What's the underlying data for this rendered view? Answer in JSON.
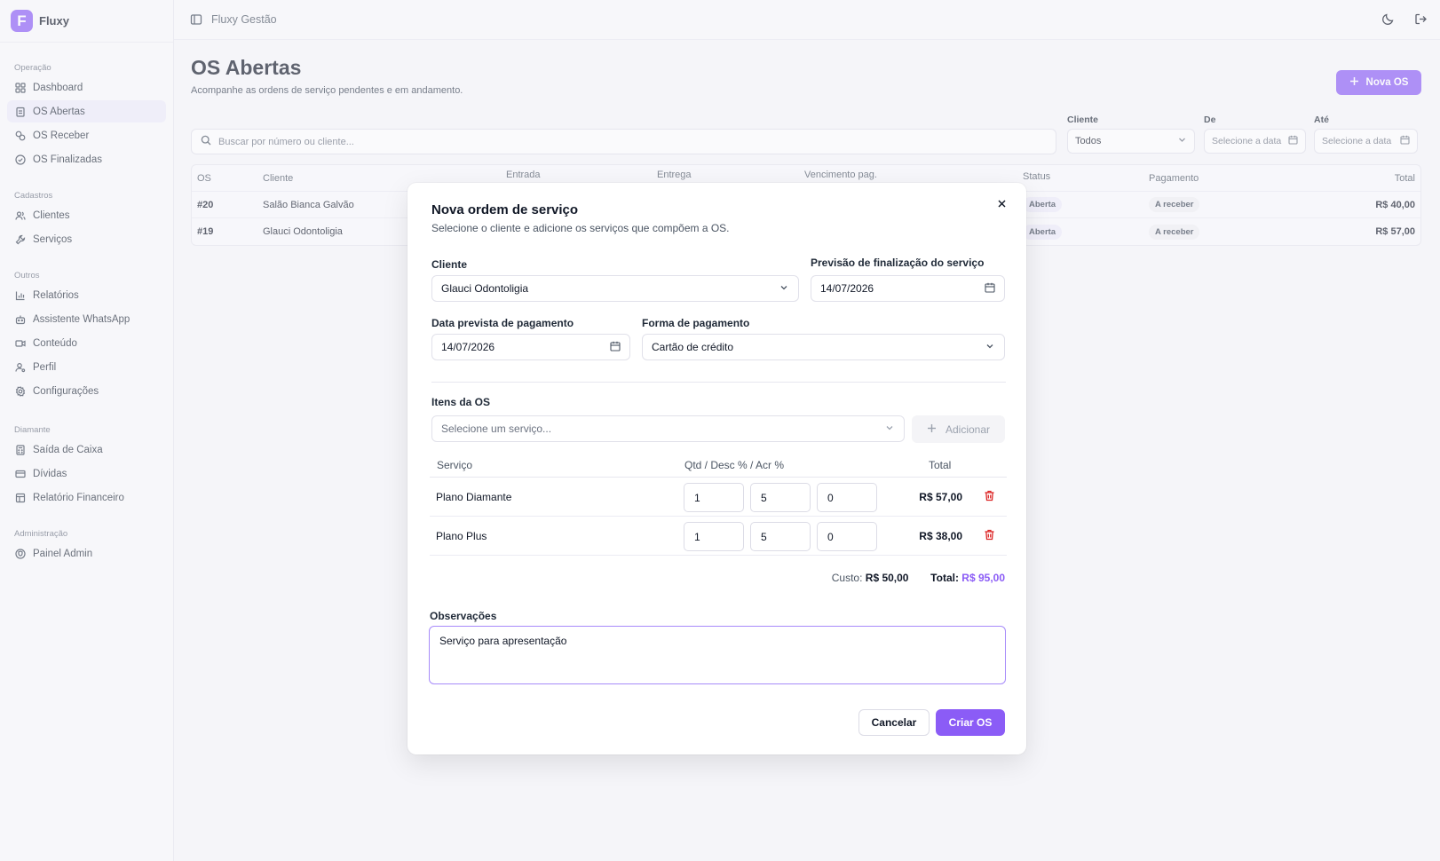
{
  "brand": {
    "logo_letter": "F",
    "name": "Fluxy",
    "color": "#8b5cf6"
  },
  "topbar": {
    "title": "Fluxy Gestão"
  },
  "sidebar": {
    "sections": [
      {
        "heading": "Operação",
        "items": [
          {
            "label": "Dashboard",
            "icon": "grid-icon"
          },
          {
            "label": "OS Abertas",
            "icon": "clipboard-icon",
            "active": true
          },
          {
            "label": "OS Receber",
            "icon": "coins-icon"
          },
          {
            "label": "OS Finalizadas",
            "icon": "check-circle-icon"
          }
        ]
      },
      {
        "heading": "Cadastros",
        "items": [
          {
            "label": "Clientes",
            "icon": "users-icon"
          },
          {
            "label": "Serviços",
            "icon": "wrench-icon"
          }
        ]
      },
      {
        "heading": "Outros",
        "items": [
          {
            "label": "Relatórios",
            "icon": "bar-chart-icon"
          },
          {
            "label": "Assistente WhatsApp",
            "icon": "bot-icon"
          },
          {
            "label": "Conteúdo",
            "icon": "video-icon"
          },
          {
            "label": "Perfil",
            "icon": "user-cog-icon"
          },
          {
            "label": "Configurações",
            "icon": "gear-icon"
          }
        ]
      },
      {
        "heading": "Diamante",
        "items": [
          {
            "label": "Saída de Caixa",
            "icon": "calculator-icon"
          },
          {
            "label": "Dívidas",
            "icon": "credit-card-icon"
          },
          {
            "label": "Relatório Financeiro",
            "icon": "file-report-icon"
          }
        ]
      },
      {
        "heading": "Administração",
        "items": [
          {
            "label": "Painel Admin",
            "icon": "shield-icon"
          }
        ]
      }
    ]
  },
  "page": {
    "title": "OS Abertas",
    "subtitle": "Acompanhe as ordens de serviço pendentes e em andamento.",
    "new_button": "Nova OS",
    "search_placeholder": "Buscar por número ou cliente...",
    "filters": {
      "cliente_label": "Cliente",
      "cliente_value": "Todos",
      "de_label": "De",
      "de_placeholder": "Selecione a data",
      "ate_label": "Até",
      "ate_placeholder": "Selecione a data"
    },
    "table": {
      "headers": [
        "OS",
        "Cliente",
        "Entrada",
        "Entrega",
        "Vencimento pag.",
        "Status",
        "Pagamento",
        "Total"
      ],
      "rows": [
        {
          "os": "#20",
          "cliente": "Salão Bianca Galvão",
          "status": "Aberta",
          "pagamento": "A receber",
          "total": "R$ 40,00"
        },
        {
          "os": "#19",
          "cliente": "Glauci Odontoligia",
          "status": "Aberta",
          "pagamento": "A receber",
          "total": "R$ 57,00"
        }
      ]
    }
  },
  "modal": {
    "title": "Nova ordem de serviço",
    "subtitle": "Selecione o cliente e adicione os serviços que compõem a OS.",
    "cliente_label": "Cliente",
    "cliente_value": "Glauci Odontoligia",
    "previsao_label": "Previsão de finalização do serviço",
    "previsao_value": "14/07/2026",
    "data_pag_label": "Data prevista de pagamento",
    "data_pag_value": "14/07/2026",
    "forma_label": "Forma de pagamento",
    "forma_value": "Cartão de crédito",
    "itens_label": "Itens da OS",
    "servico_placeholder": "Selecione um serviço...",
    "add_button": "Adicionar",
    "items_headers": {
      "servico": "Serviço",
      "qtd": "Qtd / Desc % / Acr %",
      "total": "Total"
    },
    "items": [
      {
        "name": "Plano Diamante",
        "qtd": "1",
        "desc": "5",
        "acr": "0",
        "total": "R$ 57,00"
      },
      {
        "name": "Plano Plus",
        "qtd": "1",
        "desc": "5",
        "acr": "0",
        "total": "R$ 38,00"
      }
    ],
    "custo_label": "Custo:",
    "custo_value": "R$ 50,00",
    "total_label": "Total:",
    "total_value": "R$ 95,00",
    "obs_label": "Observações",
    "obs_value": "Serviço para apresentação",
    "cancel_button": "Cancelar",
    "create_button": "Criar OS"
  }
}
